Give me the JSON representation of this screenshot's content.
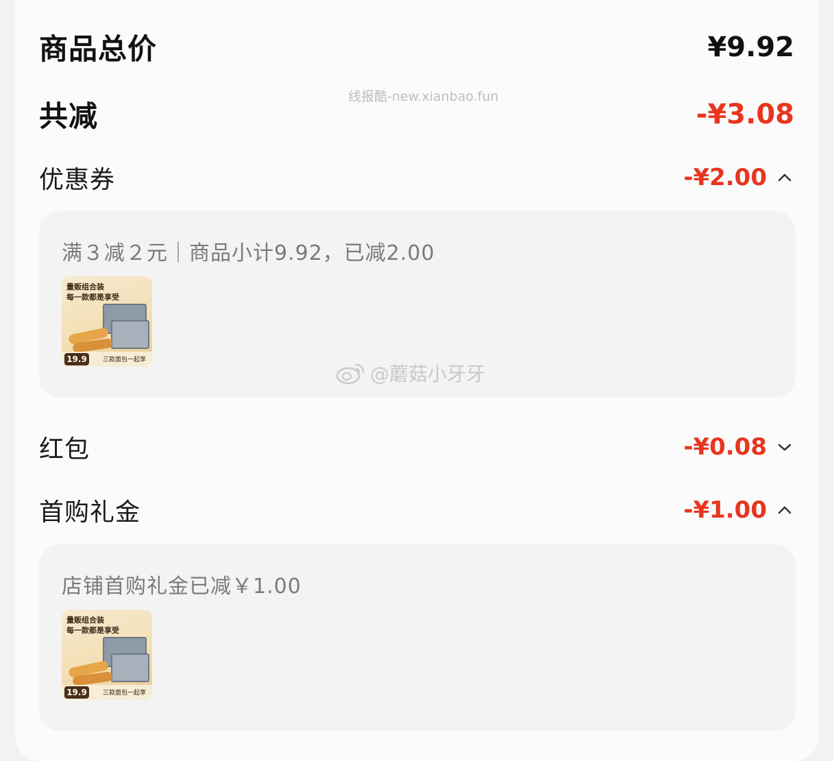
{
  "summary": {
    "total_label": "商品总价",
    "total_value": "¥9.92",
    "discount_label": "共减",
    "discount_value": "-¥3.08"
  },
  "coupon": {
    "label": "优惠券",
    "value": "-¥2.00",
    "detail": "满３减２元｜商品小计9.92，已减2.00",
    "product": {
      "line1": "量贩组合装",
      "line2": "每一款都是享受",
      "price": "19.9",
      "footer": "三款面包一起享"
    }
  },
  "red_packet": {
    "label": "红包",
    "value": "-¥0.08"
  },
  "first_purchase": {
    "label": "首购礼金",
    "value": "-¥1.00",
    "detail": "店铺首购礼金已减￥1.00",
    "product": {
      "line1": "量贩组合装",
      "line2": "每一款都是享受",
      "price": "19.9",
      "footer": "三款面包一起享"
    }
  },
  "watermarks": {
    "top": "线报酷-new.xianbao.fun",
    "weibo": "@蘑菇小牙牙"
  },
  "colors": {
    "accent_red": "#e8351f",
    "card_bg": "#f3f3f3",
    "sheet_bg": "#fbfbfb"
  }
}
